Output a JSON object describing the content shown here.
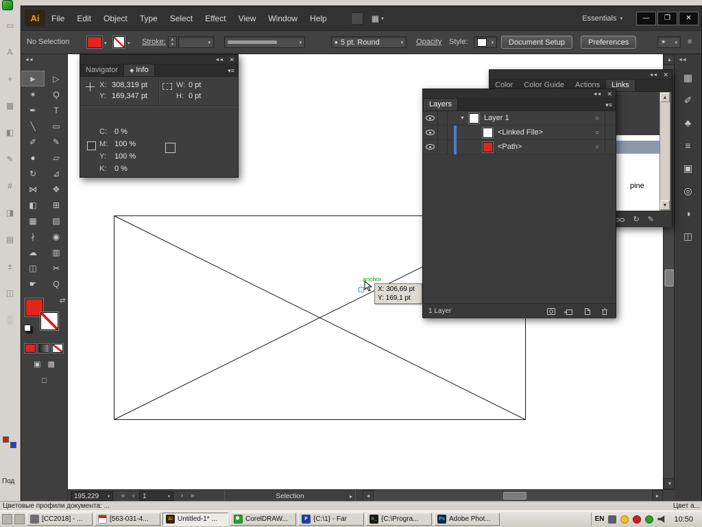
{
  "colors": {
    "fill_red": "#e1251b",
    "layer_bar_blue": "#4f7cc4",
    "anchor_green": "#18a318",
    "anchor_point_blue": "#3fa9f5",
    "links_selected_row": "#8b99ad"
  },
  "icons": {
    "collapse": "◄◄",
    "close": "✕",
    "menu": "≡",
    "panel_menu": "▾≡",
    "dropdown": "▾",
    "minimize": "—",
    "restore": "❐",
    "swap": "⇄",
    "target": "○",
    "disclosure": "▼",
    "nav_first": "«",
    "nav_prev": "‹",
    "nav_next": "›",
    "nav_last": "»",
    "scroll_up": "▲",
    "scroll_down": "▼",
    "scroll_left": "◄",
    "scroll_right": "►",
    "status_arrow": "▸",
    "brush_preview": "●",
    "tab_marker": "◆",
    "arrange_grid": "▦",
    "wand": "✶",
    "step_up": "▴",
    "step_down": "▾",
    "draw_normal": "▣",
    "draw_behind": "▩",
    "screen_mode": "□",
    "refresh": "↻",
    "pencil": "✎"
  },
  "app": {
    "logo": "Ai",
    "menus": [
      "File",
      "Edit",
      "Object",
      "Type",
      "Select",
      "Effect",
      "View",
      "Window",
      "Help"
    ],
    "workspace": "Essentials"
  },
  "control_bar": {
    "selection_status": "No Selection",
    "stroke_label": "Stroke:",
    "brush_name": "5 pt. Round",
    "opacity_label": "Opacity",
    "style_label": "Style:",
    "document_setup_label": "Document Setup",
    "preferences_label": "Preferences"
  },
  "tools": [
    {
      "name": "selection",
      "glyph": "►"
    },
    {
      "name": "direct-selection",
      "glyph": "▷"
    },
    {
      "name": "magic-wand",
      "glyph": "✶"
    },
    {
      "name": "lasso",
      "glyph": "Ǫ"
    },
    {
      "name": "pen",
      "glyph": "✒"
    },
    {
      "name": "type",
      "glyph": "T"
    },
    {
      "name": "line-segment",
      "glyph": "╲"
    },
    {
      "name": "rectangle",
      "glyph": "▭"
    },
    {
      "name": "paintbrush",
      "glyph": "✐"
    },
    {
      "name": "pencil",
      "glyph": "✎"
    },
    {
      "name": "blob-brush",
      "glyph": "●"
    },
    {
      "name": "eraser",
      "glyph": "▱"
    },
    {
      "name": "rotate",
      "glyph": "↻"
    },
    {
      "name": "scale",
      "glyph": "⊿"
    },
    {
      "name": "width",
      "glyph": "⋈"
    },
    {
      "name": "free-transform",
      "glyph": "✥"
    },
    {
      "name": "shape-builder",
      "glyph": "◧"
    },
    {
      "name": "perspective-grid",
      "glyph": "⊞"
    },
    {
      "name": "mesh",
      "glyph": "▦"
    },
    {
      "name": "gradient",
      "glyph": "▧"
    },
    {
      "name": "eyedropper",
      "glyph": "∤"
    },
    {
      "name": "blend",
      "glyph": "◉"
    },
    {
      "name": "symbol-sprayer",
      "glyph": "☁"
    },
    {
      "name": "column-graph",
      "glyph": "▥"
    },
    {
      "name": "artboard",
      "glyph": "◫"
    },
    {
      "name": "slice",
      "glyph": "✂"
    },
    {
      "name": "hand",
      "glyph": "☛"
    },
    {
      "name": "zoom",
      "glyph": "Q"
    }
  ],
  "dock_icons": [
    {
      "name": "swatches",
      "glyph": "▦"
    },
    {
      "name": "brushes",
      "glyph": "✐"
    },
    {
      "name": "symbols",
      "glyph": "♣"
    },
    {
      "name": "stroke",
      "glyph": "≡"
    },
    {
      "name": "graphic-styles",
      "glyph": "▣"
    },
    {
      "name": "appearance",
      "glyph": "◎"
    },
    {
      "name": "color-guide",
      "glyph": "◑"
    },
    {
      "name": "artboards",
      "glyph": "◫"
    }
  ],
  "info_panel": {
    "tab_navigator": "Navigator",
    "tab_info": "Info",
    "x_label": "X:",
    "x_value": "308,319 pt",
    "y_label": "Y:",
    "y_value": "169,347 pt",
    "w_label": "W:",
    "w_value": "0 pt",
    "h_label": "H:",
    "h_value": "0 pt",
    "cmyk": [
      {
        "label": "C:",
        "value": "0 %"
      },
      {
        "label": "M:",
        "value": "100 %"
      },
      {
        "label": "Y:",
        "value": "100 %"
      },
      {
        "label": "K:",
        "value": "0 %"
      }
    ]
  },
  "links_panel": {
    "tabs": [
      "Color",
      "Color Guide",
      "Actions",
      "Links"
    ],
    "active_tab": "Links",
    "item": "pine"
  },
  "layers_panel": {
    "tab": "Layers",
    "rows": [
      {
        "label": "Layer 1"
      },
      {
        "label": "<Linked File>"
      },
      {
        "label": "<Path>"
      }
    ],
    "footer": "1 Layer"
  },
  "canvas": {
    "anchor_label": "anchor",
    "tooltip_line1": "X: 306,69 pt",
    "tooltip_line2": "Y: 169,1 pt"
  },
  "status_bar": {
    "zoom": "195,229",
    "artboard": "1",
    "status": "Selection"
  },
  "desktop": {
    "left_label": "Под",
    "strip_icons": [
      "▭",
      "A",
      "+",
      "▦",
      "◧",
      "✎",
      "#",
      "◨",
      "▤",
      "±",
      "◫",
      "░"
    ],
    "status_left": "Цветовые профили документа: ...",
    "status_right": "Цвет а..."
  },
  "taskbar": {
    "buttons": [
      {
        "label": "[CC2018] - ...",
        "icon_text": ""
      },
      {
        "label": "[563-031-4...",
        "icon_text": ""
      },
      {
        "label": "Untitled-1* ...",
        "icon_text": "Ai"
      },
      {
        "label": "CorelDRAW...",
        "icon_text": ""
      },
      {
        "label": "{C:\\1} - Far",
        "icon_text": "F"
      },
      {
        "label": "{C:\\Progra...",
        "icon_text": ">_"
      },
      {
        "label": "Adobe Phot...",
        "icon_text": "Ps"
      }
    ],
    "language": "EN",
    "clock": "10:50"
  }
}
